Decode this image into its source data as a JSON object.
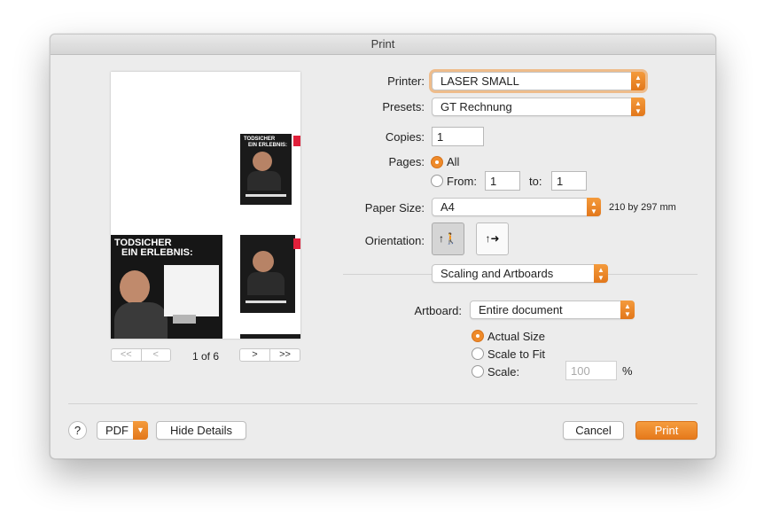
{
  "window": {
    "title": "Print"
  },
  "preview": {
    "page_indicator": "1 of 6",
    "nav_first": "<<",
    "nav_prev": "<",
    "nav_next": ">",
    "nav_last": ">>",
    "poster_headline_1": "TODSICHER",
    "poster_headline_2": "EIN ERLEBNIS:",
    "small_headline_1": "TODSICHER",
    "small_headline_2": "EIN ERLEBNIS:"
  },
  "printer": {
    "label": "Printer:",
    "value": "LASER SMALL"
  },
  "presets": {
    "label": "Presets:",
    "value": "GT Rechnung"
  },
  "copies": {
    "label": "Copies:",
    "value": "1"
  },
  "pages": {
    "label": "Pages:",
    "all_label": "All",
    "from_label": "From:",
    "from_value": "1",
    "to_label": "to:",
    "to_value": "1",
    "selected": "All"
  },
  "paper_size": {
    "label": "Paper Size:",
    "value": "A4",
    "dimensions": "210 by 297 mm"
  },
  "orientation": {
    "label": "Orientation:",
    "selected": "portrait"
  },
  "section_popup": {
    "value": "Scaling and Artboards"
  },
  "artboard": {
    "label": "Artboard:",
    "value": "Entire document"
  },
  "scaling": {
    "actual_size_label": "Actual Size",
    "scale_to_fit_label": "Scale to Fit",
    "scale_label": "Scale:",
    "scale_value": "100",
    "percent": "%",
    "selected": "Actual Size"
  },
  "footer": {
    "help": "?",
    "pdf": "PDF",
    "hide_details": "Hide Details",
    "cancel": "Cancel",
    "print": "Print"
  },
  "colors": {
    "accent": "#ee8a2a",
    "window_bg": "#ececec"
  }
}
